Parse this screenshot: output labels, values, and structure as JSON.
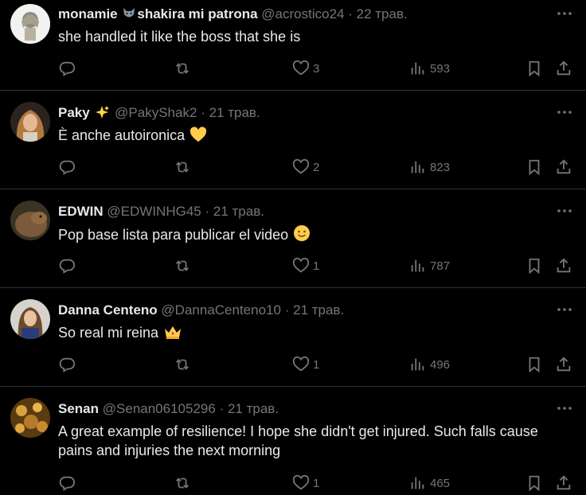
{
  "tweets": [
    {
      "name": "monamie",
      "name_suffix": "shakira mi patrona",
      "handle": "@acrostico24",
      "date": "22 трав.",
      "text": "she handled it like the boss that she is",
      "likes": "3",
      "views": "593"
    },
    {
      "name": "Paky",
      "handle": "@PakyShak2",
      "date": "21 трав.",
      "text": "È anche autoironica",
      "likes": "2",
      "views": "823"
    },
    {
      "name": "EDWIN",
      "handle": "@EDWINHG45",
      "date": "21 трав.",
      "text": "Pop base lista para publicar el video",
      "likes": "1",
      "views": "787"
    },
    {
      "name": "Danna Centeno",
      "handle": "@DannaCenteno10",
      "date": "21 трав.",
      "text": "So real mi reina",
      "likes": "1",
      "views": "496"
    },
    {
      "name": "Senan",
      "handle": "@Senan06105296",
      "date": "21 трав.",
      "text": "A great example of resilience! I hope she didn't get injured. Such falls cause pains and injuries the next morning",
      "likes": "1",
      "views": "465"
    }
  ],
  "separator": "·",
  "colors": {
    "background": "#000000",
    "text": "#e7e9ea",
    "muted": "#71767b",
    "border": "#2f3336"
  },
  "icons": [
    "reply-icon",
    "retweet-icon",
    "like-icon",
    "views-icon",
    "bookmark-icon",
    "share-icon",
    "more-icon"
  ]
}
